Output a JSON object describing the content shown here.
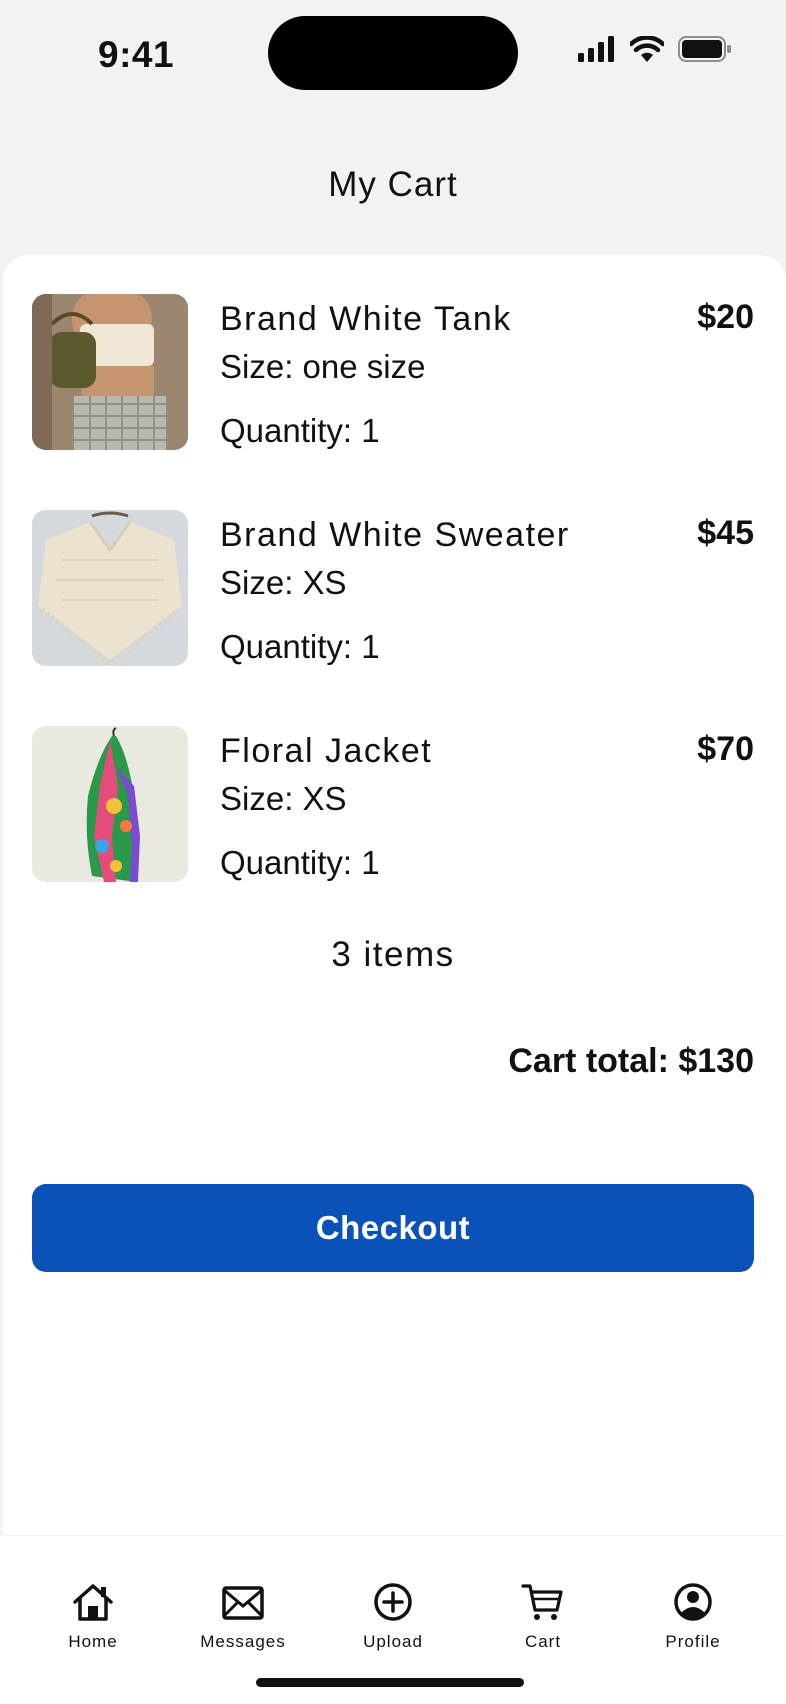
{
  "status": {
    "time": "9:41"
  },
  "header": {
    "title": "My Cart"
  },
  "items": [
    {
      "name": "Brand White Tank",
      "price": "$20",
      "size": "Size: one size",
      "quantity": "Quantity: 1"
    },
    {
      "name": "Brand White Sweater",
      "price": "$45",
      "size": "Size: XS",
      "quantity": "Quantity: 1"
    },
    {
      "name": "Floral Jacket",
      "price": "$70",
      "size": "Size: XS",
      "quantity": "Quantity: 1"
    }
  ],
  "summary": {
    "count": "3 items",
    "total": "Cart total: $130"
  },
  "checkout": {
    "label": "Checkout",
    "color": "#0a52b8"
  },
  "tabs": [
    {
      "label": "Home",
      "icon": "home-icon"
    },
    {
      "label": "Messages",
      "icon": "envelope-icon"
    },
    {
      "label": "Upload",
      "icon": "plus-circle-icon"
    },
    {
      "label": "Cart",
      "icon": "cart-icon"
    },
    {
      "label": "Profile",
      "icon": "user-circle-icon"
    }
  ]
}
